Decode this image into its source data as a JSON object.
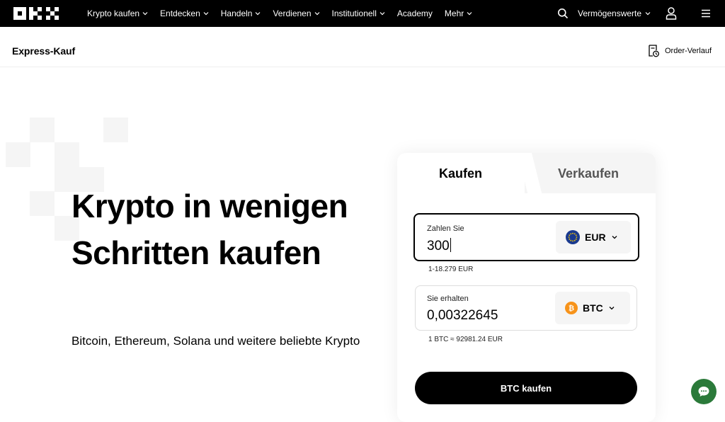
{
  "nav": {
    "logo_name": "OKX",
    "items": [
      {
        "label": "Krypto kaufen",
        "has_dropdown": true
      },
      {
        "label": "Entdecken",
        "has_dropdown": true
      },
      {
        "label": "Handeln",
        "has_dropdown": true
      },
      {
        "label": "Verdienen",
        "has_dropdown": true
      },
      {
        "label": "Institutionell",
        "has_dropdown": true
      },
      {
        "label": "Academy",
        "has_dropdown": false
      },
      {
        "label": "Mehr",
        "has_dropdown": true
      }
    ],
    "assets_label": "Vermögenswerte",
    "icons": {
      "search": "search-icon",
      "user": "user-icon",
      "menu": "hamburger-menu-icon"
    }
  },
  "subheader": {
    "title": "Express-Kauf",
    "order_history_label": "Order-Verlauf",
    "order_history_icon": "receipt-clock-icon"
  },
  "hero": {
    "title": "Krypto in wenigen Schritten kaufen",
    "subtitle": "Bitcoin, Ethereum, Solana und weitere beliebte Krypto"
  },
  "card": {
    "tabs": {
      "buy": "Kaufen",
      "sell": "Verkaufen",
      "active": "buy"
    },
    "pay": {
      "label": "Zahlen Sie",
      "value": "300",
      "currency": "EUR",
      "currency_icon": "eu-flag-icon",
      "range_hint": "1-18.279 EUR"
    },
    "receive": {
      "label": "Sie erhalten",
      "value": "0,00322645",
      "currency": "BTC",
      "currency_icon": "bitcoin-icon",
      "rate_hint": "1 BTC ≈ 92981.24 EUR"
    },
    "submit_label": "BTC kaufen"
  },
  "chat": {
    "icon": "chat-bubble-icon"
  },
  "colors": {
    "nav_bg": "#000000",
    "accent": "#000000",
    "chat_bg": "#2b7a3a",
    "eur_blue": "#1a3a8f",
    "btc_orange": "#f7931a"
  }
}
